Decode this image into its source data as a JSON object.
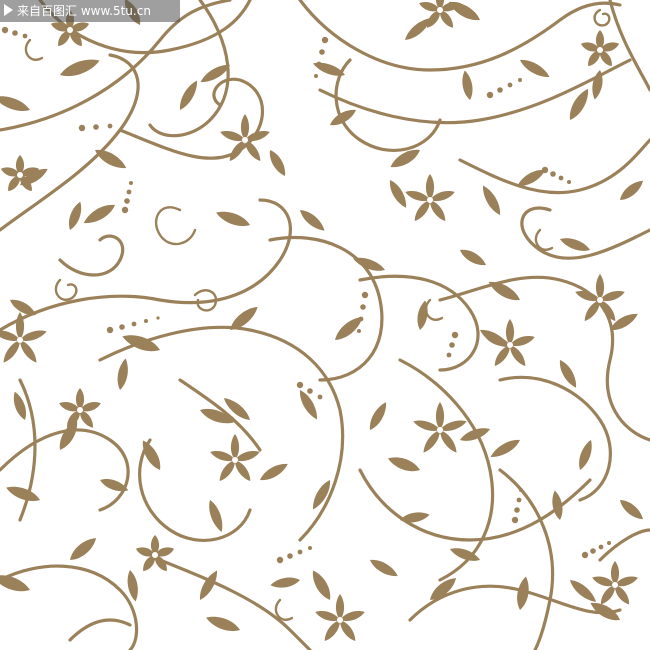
{
  "watermark": {
    "text": "来自百图汇 www.5tu.cn",
    "icon": "play-icon"
  },
  "pattern": {
    "ink_color": "#9b8159",
    "background_color": "#ffffff"
  }
}
